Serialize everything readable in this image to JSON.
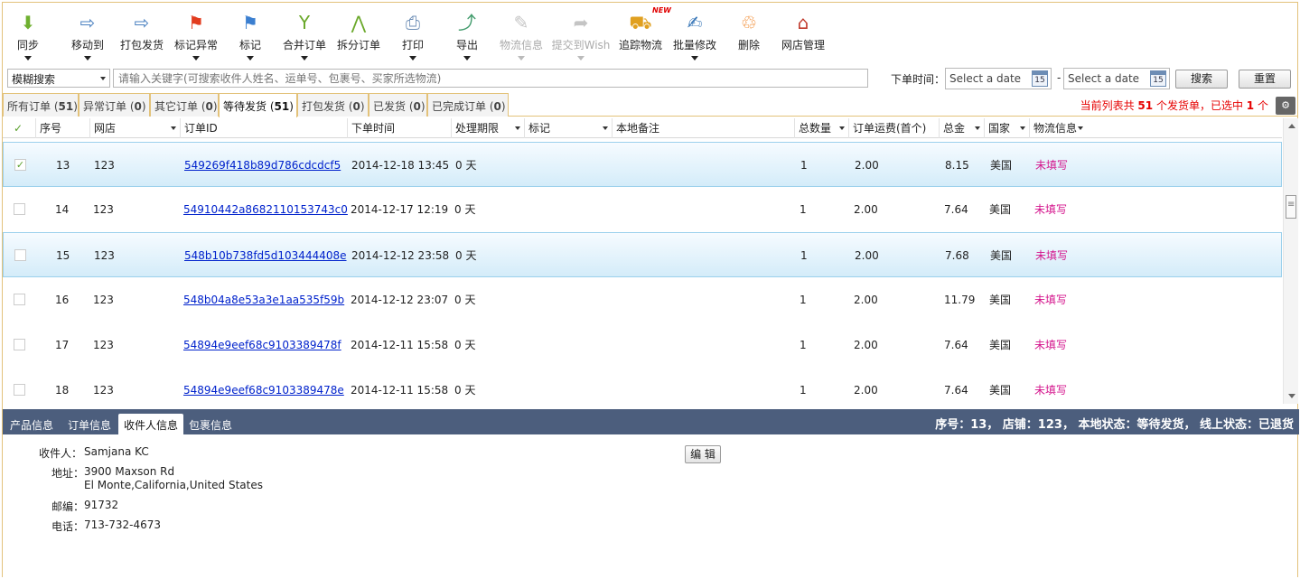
{
  "toolbar": [
    {
      "label": "同步",
      "icon": "download-arrow-icon",
      "dropdown": true,
      "disabled": false
    },
    {
      "label": "移动到",
      "icon": "move-box-icon",
      "dropdown": true,
      "disabled": false
    },
    {
      "label": "打包发货",
      "icon": "ship-box-icon",
      "dropdown": false,
      "disabled": false
    },
    {
      "label": "标记异常",
      "icon": "red-flag-icon",
      "dropdown": true,
      "disabled": false
    },
    {
      "label": "标记",
      "icon": "blue-flag-icon",
      "dropdown": true,
      "disabled": false
    },
    {
      "label": "合并订单",
      "icon": "merge-icon",
      "dropdown": true,
      "disabled": false
    },
    {
      "label": "拆分订单",
      "icon": "split-icon",
      "dropdown": false,
      "disabled": false
    },
    {
      "label": "打印",
      "icon": "printer-icon",
      "dropdown": true,
      "disabled": false
    },
    {
      "label": "导出",
      "icon": "export-icon",
      "dropdown": true,
      "disabled": false
    },
    {
      "label": "物流信息",
      "icon": "pencil-icon",
      "dropdown": true,
      "disabled": true
    },
    {
      "label": "提交到Wish",
      "icon": "share-arrow-icon",
      "dropdown": true,
      "disabled": true
    },
    {
      "label": "追踪物流",
      "icon": "truck-icon",
      "dropdown": false,
      "disabled": false,
      "badge": "NEW"
    },
    {
      "label": "批量修改",
      "icon": "batch-edit-icon",
      "dropdown": true,
      "disabled": false
    },
    {
      "label": "删除",
      "icon": "trash-icon",
      "dropdown": false,
      "disabled": false
    },
    {
      "label": "网店管理",
      "icon": "shop-icon",
      "dropdown": false,
      "disabled": false
    }
  ],
  "search": {
    "mode": "模糊搜索",
    "placeholder": "请输入关键字(可搜索收件人姓名、运单号、包裹号、买家所选物流)",
    "date_label": "下单时间：",
    "date_from_placeholder": "Select a date",
    "date_to_placeholder": "Select a date",
    "date_icon_text": "15",
    "separator": "-",
    "search_button": "搜索",
    "reset_button": "重置"
  },
  "tabs": [
    {
      "label": "所有订单",
      "count": "51"
    },
    {
      "label": "异常订单",
      "count": "0"
    },
    {
      "label": "其它订单",
      "count": "0"
    },
    {
      "label": "等待发货",
      "count": "51",
      "active": true
    },
    {
      "label": "打包发货",
      "count": "0"
    },
    {
      "label": "已发货",
      "count": "0"
    },
    {
      "label": "已完成订单",
      "count": "0"
    }
  ],
  "summary": {
    "prefix": "当前列表共",
    "total": "51",
    "mid": "个发货单，已选中",
    "selected": "1",
    "suffix": "个"
  },
  "columns": [
    {
      "label": "✓",
      "sort": false
    },
    {
      "label": "序号",
      "sort": false
    },
    {
      "label": "网店",
      "sort": true
    },
    {
      "label": "订单ID",
      "sort": false
    },
    {
      "label": "下单时间",
      "sort": false
    },
    {
      "label": "处理期限",
      "sort": true
    },
    {
      "label": "标记",
      "sort": true
    },
    {
      "label": "本地备注",
      "sort": false
    },
    {
      "label": "总数量",
      "sort": true
    },
    {
      "label": "订单运费(首个)",
      "sort": false
    },
    {
      "label": "总金",
      "sort": true
    },
    {
      "label": "国家",
      "sort": true
    },
    {
      "label": "物流信息",
      "sort": true
    }
  ],
  "rows": [
    {
      "checked": true,
      "highlight": true,
      "no": "13",
      "shop": "123",
      "order_id": "549269f418b89d786cdcdcf5",
      "date": "2014-12-18 13:45",
      "deadline": "0 天",
      "qty": "1",
      "shipping": "2.00",
      "total": "8.15",
      "country": "美国",
      "logistics": "未填写"
    },
    {
      "checked": false,
      "highlight": false,
      "no": "14",
      "shop": "123",
      "order_id": "54910442a8682110153743c0",
      "date": "2014-12-17 12:19",
      "deadline": "0 天",
      "qty": "1",
      "shipping": "2.00",
      "total": "7.64",
      "country": "美国",
      "logistics": "未填写"
    },
    {
      "checked": false,
      "highlight": true,
      "no": "15",
      "shop": "123",
      "order_id": "548b10b738fd5d103444408e",
      "date": "2014-12-12 23:58",
      "deadline": "0 天",
      "qty": "1",
      "shipping": "2.00",
      "total": "7.68",
      "country": "美国",
      "logistics": "未填写"
    },
    {
      "checked": false,
      "highlight": false,
      "no": "16",
      "shop": "123",
      "order_id": "548b04a8e53a3e1aa535f59b",
      "date": "2014-12-12 23:07",
      "deadline": "0 天",
      "qty": "1",
      "shipping": "2.00",
      "total": "11.79",
      "country": "美国",
      "logistics": "未填写"
    },
    {
      "checked": false,
      "highlight": false,
      "no": "17",
      "shop": "123",
      "order_id": "54894e9eef68c9103389478f",
      "date": "2014-12-11 15:58",
      "deadline": "0 天",
      "qty": "1",
      "shipping": "2.00",
      "total": "7.64",
      "country": "美国",
      "logistics": "未填写"
    },
    {
      "checked": false,
      "highlight": false,
      "no": "18",
      "shop": "123",
      "order_id": "54894e9eef68c9103389478e",
      "date": "2014-12-11 15:58",
      "deadline": "0 天",
      "qty": "1",
      "shipping": "2.00",
      "total": "7.64",
      "country": "美国",
      "logistics": "未填写"
    }
  ],
  "detail": {
    "tabs": [
      {
        "label": "产品信息"
      },
      {
        "label": "订单信息"
      },
      {
        "label": "收件人信息",
        "active": true
      },
      {
        "label": "包裹信息"
      }
    ],
    "status": "序号：13， 店铺：123， 本地状态：等待发货， 线上状态：已退货",
    "recipient_label": "收件人：",
    "recipient": "Samjana KC",
    "address_label": "地址：",
    "address_line1": "3900 Maxson Rd",
    "address_line2": "El Monte,California,United States",
    "zip_label": "邮编：",
    "zip": "91732",
    "phone_label": "电话：",
    "phone": "713-732-4673",
    "edit_button": "编 辑"
  },
  "colors": {
    "accent_border": "#e3c27a",
    "detail_bar": "#4c5e7d",
    "link": "#0022cc",
    "logistics_text": "#d4148c",
    "summary_text": "#e60000"
  }
}
